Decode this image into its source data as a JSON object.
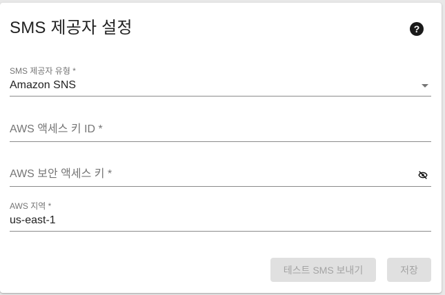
{
  "dialog": {
    "title": "SMS 제공자 설정",
    "help_icon": "question-mark-icon"
  },
  "fields": {
    "provider_type": {
      "label": "SMS 제공자 유형 *",
      "value": "Amazon SNS",
      "icon": "dropdown-arrow-icon"
    },
    "access_key_id": {
      "placeholder": "AWS 액세스 키 ID *",
      "value": ""
    },
    "secret_access_key": {
      "placeholder": "AWS 보안 액세스 키 *",
      "value": "",
      "icon": "visibility-off-icon"
    },
    "region": {
      "label": "AWS 지역 *",
      "value": "us-east-1"
    }
  },
  "actions": {
    "test_label": "테스트 SMS 보내기",
    "save_label": "저장"
  },
  "colors": {
    "button_disabled_bg": "#e0e0e0",
    "button_disabled_text": "#a3a3a3",
    "underline": "#8a8a8a"
  }
}
